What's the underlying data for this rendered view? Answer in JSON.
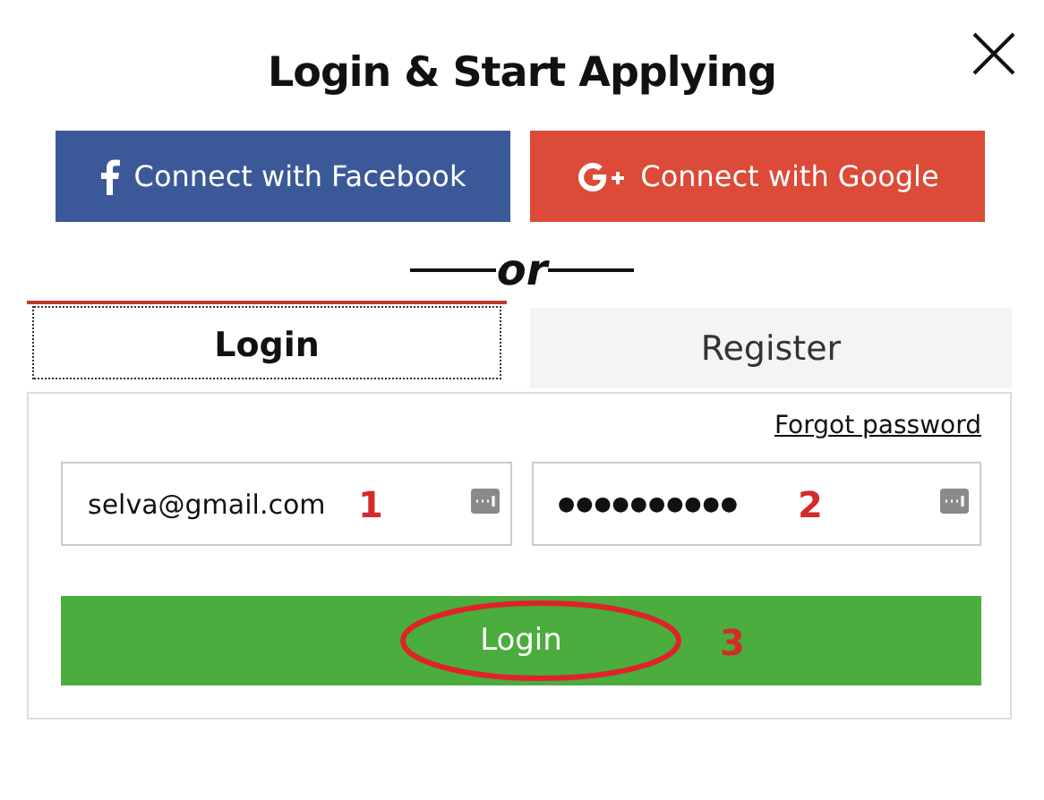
{
  "dialog": {
    "title": "Login & Start Applying"
  },
  "social_buttons": [
    {
      "kind": "facebook",
      "label": "Connect with Facebook"
    },
    {
      "kind": "google",
      "label": "Connect with Google"
    }
  ],
  "divider": {
    "label": "or"
  },
  "tabs": [
    {
      "label": "Login",
      "selected": true
    },
    {
      "label": "Register",
      "selected": false
    }
  ],
  "forgot_password": "Forgot password",
  "fields": [
    {
      "kind": "email",
      "value": "selva@gmail.com",
      "annotation": "1"
    },
    {
      "kind": "password",
      "value": "●●●●●●●●●●",
      "annotation": "2"
    }
  ],
  "login_button": {
    "label": "Login",
    "annotation": "3",
    "highlighted": true
  }
}
